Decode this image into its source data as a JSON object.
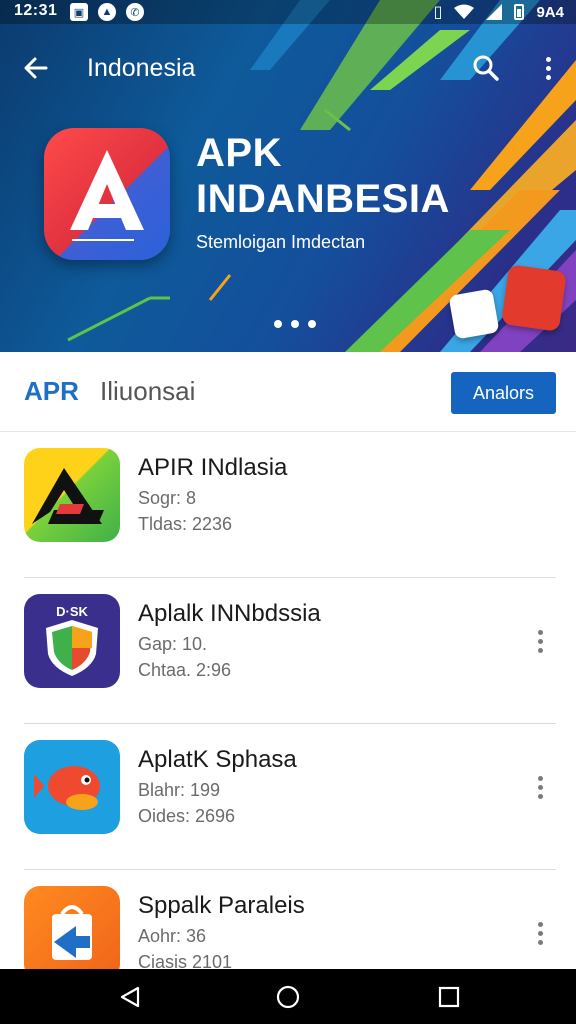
{
  "status_bar": {
    "time": "12:31",
    "battery_text": "9A4"
  },
  "app_bar": {
    "title": "Indonesia"
  },
  "hero": {
    "title_line1": "APK",
    "title_line2": "INDANBESIA",
    "subtitle": "Stemloigan Imdectan"
  },
  "section": {
    "brand": "APR",
    "title_rest": "Iliuonsai",
    "button_label": "Analors"
  },
  "apps": [
    {
      "name": "APIR INdlasia",
      "line1": "Sogr: 8",
      "line2": "Tldas: 2236",
      "has_more": false
    },
    {
      "name": "Aplalk INNbdssia",
      "line1": "Gap: 10.",
      "line2": "Chtaa. 2:96",
      "has_more": true
    },
    {
      "name": "AplatK Sphasa",
      "line1": "Blahr: 199",
      "line2": "Oides: 2696",
      "has_more": true
    },
    {
      "name": "Sppalk Paraleis",
      "line1": "Aohr: 36",
      "line2": "Ciasis 2101",
      "has_more": true
    }
  ],
  "colors": {
    "accent": "#1565c0",
    "brand_blue": "#1f6fc7",
    "hero_bg": "#0e5a9a"
  }
}
